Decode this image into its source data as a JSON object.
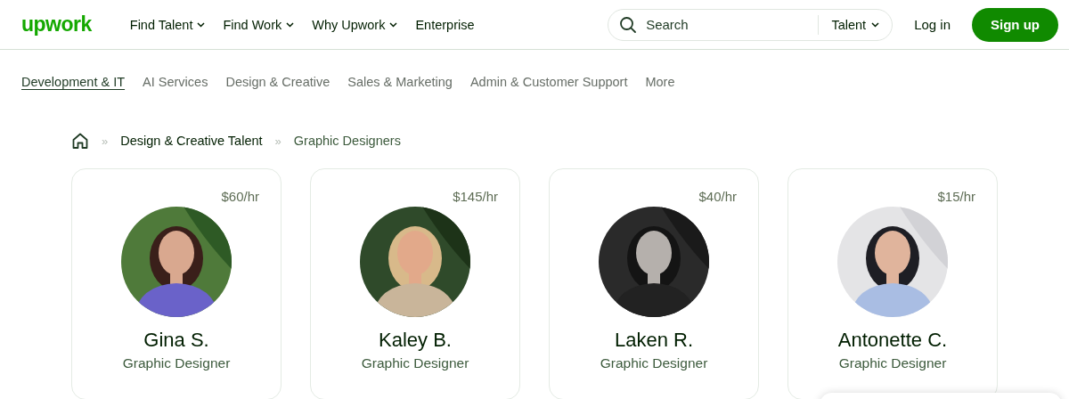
{
  "header": {
    "logo": "upwork",
    "nav": [
      {
        "label": "Find Talent",
        "dropdown": true
      },
      {
        "label": "Find Work",
        "dropdown": true
      },
      {
        "label": "Why Upwork",
        "dropdown": true
      },
      {
        "label": "Enterprise",
        "dropdown": false
      }
    ],
    "search": {
      "placeholder": "Search",
      "scope": "Talent"
    },
    "login": "Log in",
    "signup": "Sign up"
  },
  "categories": [
    {
      "label": "Development & IT",
      "selected": true
    },
    {
      "label": "AI Services",
      "selected": false
    },
    {
      "label": "Design & Creative",
      "selected": false
    },
    {
      "label": "Sales & Marketing",
      "selected": false
    },
    {
      "label": "Admin & Customer Support",
      "selected": false
    },
    {
      "label": "More",
      "selected": false
    }
  ],
  "breadcrumb": {
    "separator": "»",
    "items": [
      "Design & Creative Talent",
      "Graphic Designers"
    ]
  },
  "cards": [
    {
      "rate": "$60/hr",
      "name": "Gina S.",
      "title": "Graphic Designer"
    },
    {
      "rate": "$145/hr",
      "name": "Kaley B.",
      "title": "Graphic Designer"
    },
    {
      "rate": "$40/hr",
      "name": "Laken R.",
      "title": "Graphic Designer"
    },
    {
      "rate": "$15/hr",
      "name": "Antonette C.",
      "title": "Graphic Designer"
    }
  ]
}
